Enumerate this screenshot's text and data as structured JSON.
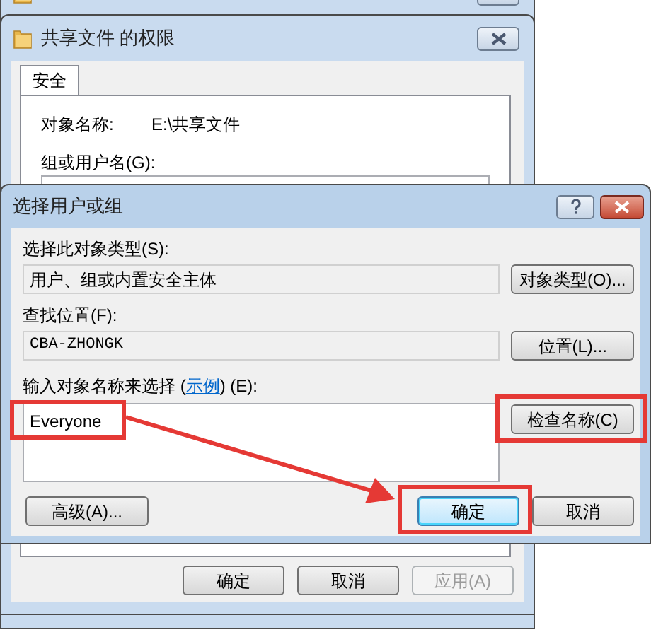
{
  "permissions_window": {
    "title": "共享文件 的权限",
    "tabs": [
      {
        "label": "安全",
        "selected": true
      }
    ],
    "object_name_label": "对象名称:",
    "object_name": "E:\\共享文件",
    "group_label": "组或用户名(G):",
    "buttons": [
      {
        "label": "确定",
        "disabled": false
      },
      {
        "label": "取消",
        "disabled": false
      },
      {
        "label": "应用(A)",
        "disabled": true
      }
    ]
  },
  "select_dialog": {
    "title": "选择用户或组",
    "object_type_label": "选择此对象类型(S):",
    "object_type": "用户、组或内置安全主体",
    "object_type_button": "对象类型(O)...",
    "location_label": "查找位置(F):",
    "location": "CBA-ZHONGK",
    "location_button": "位置(L)...",
    "names_label_before": "输入对象名称来选择 (",
    "example_link": "示例",
    "names_label_after": ") (E):",
    "names_value": "Everyone",
    "check_names_button": "检查名称(C)",
    "advanced_button": "高级(A)...",
    "buttons": [
      {
        "label": "确定",
        "focused": true
      },
      {
        "label": "取消",
        "focused": false
      }
    ]
  }
}
